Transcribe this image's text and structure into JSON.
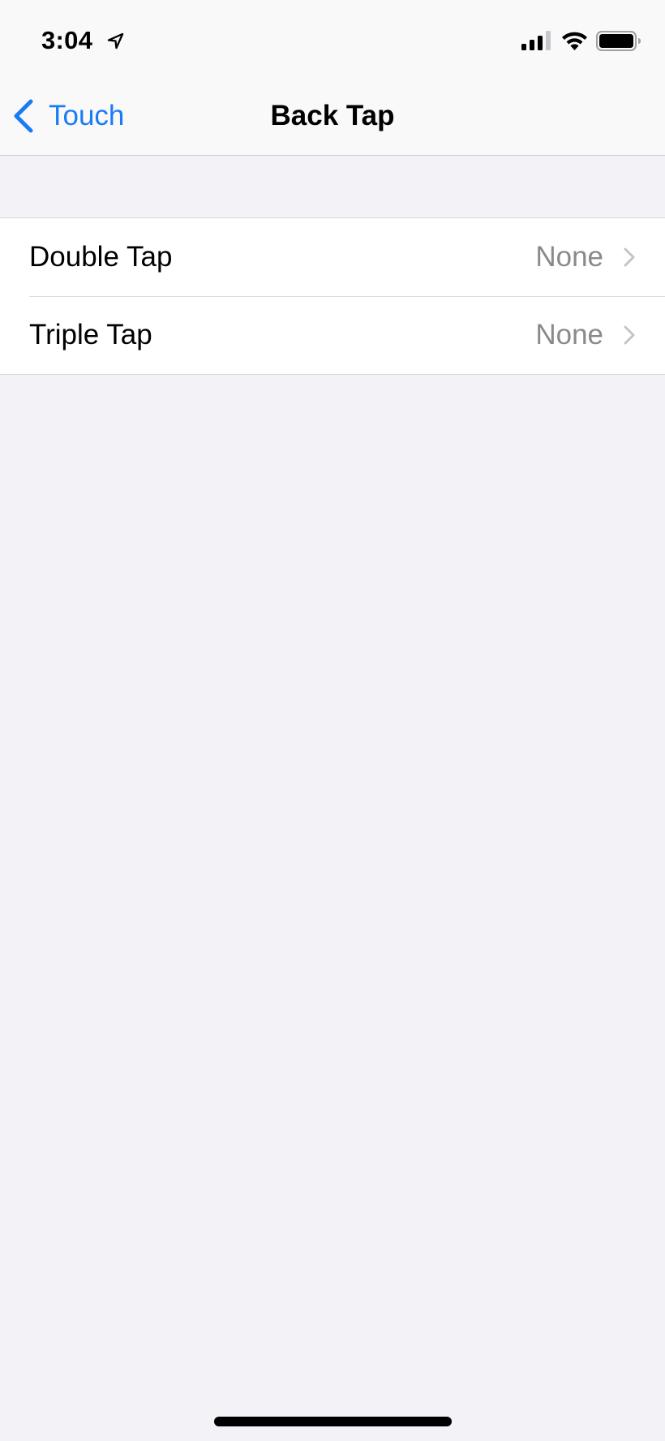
{
  "status_bar": {
    "time": "3:04",
    "icons": [
      "location-arrow-icon",
      "cellular-signal-icon",
      "wifi-icon",
      "battery-icon"
    ],
    "signal_bars_active": 3,
    "signal_bars_total": 4,
    "battery_level": 1.0
  },
  "nav": {
    "back_label": "Touch",
    "title": "Back Tap",
    "accent_color": "#1a7cf5"
  },
  "settings": {
    "rows": [
      {
        "label": "Double Tap",
        "value": "None"
      },
      {
        "label": "Triple Tap",
        "value": "None"
      }
    ]
  }
}
